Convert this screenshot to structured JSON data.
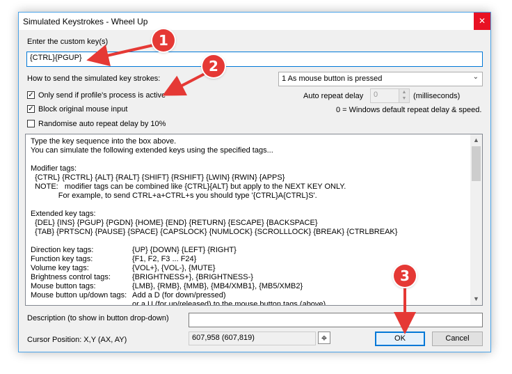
{
  "window": {
    "title": "Simulated Keystrokes - Wheel Up",
    "close_glyph": "✕"
  },
  "custom_key": {
    "label": "Enter the custom key(s)",
    "value": "{CTRL}{PGUP}"
  },
  "send_method": {
    "label": "How to send the simulated key strokes:",
    "selected": "1 As mouse button is pressed"
  },
  "options": {
    "only_send": {
      "label": "Only send if profile's process is active",
      "checked": true
    },
    "block_input": {
      "label": "Block original mouse input",
      "checked": true
    },
    "randomise": {
      "label": "Randomise auto repeat delay by 10%",
      "checked": false
    }
  },
  "auto_repeat": {
    "label": "Auto repeat delay",
    "value": "0",
    "units": "(milliseconds)",
    "note": "0 = Windows default repeat delay & speed."
  },
  "help_lines": [
    {
      "c1": "Type the key sequence into the box above.",
      "c2": ""
    },
    {
      "c1": "You can simulate the following extended keys using the specified tags...",
      "c2": ""
    },
    {
      "c1": "",
      "c2": ""
    },
    {
      "c1": "Modifier tags:",
      "c2": ""
    },
    {
      "c1": "  {CTRL} {RCTRL} {ALT} {RALT} {SHIFT} {RSHIFT} {LWIN} {RWIN} {APPS}",
      "c2": ""
    },
    {
      "c1": "  NOTE:   modifier tags can be combined like {CTRL}{ALT} but apply to the NEXT KEY ONLY.",
      "c2": ""
    },
    {
      "c1": "             For example, to send CTRL+a+CTRL+s you should type '{CTRL}A{CTRL}S'.",
      "c2": ""
    },
    {
      "c1": "",
      "c2": ""
    },
    {
      "c1": "Extended key tags:",
      "c2": ""
    },
    {
      "c1": "  {DEL} {INS} {PGUP} {PGDN} {HOME} {END} {RETURN} {ESCAPE} {BACKSPACE}",
      "c2": ""
    },
    {
      "c1": "  {TAB} {PRTSCN} {PAUSE} {SPACE} {CAPSLOCK} {NUMLOCK} {SCROLLLOCK} {BREAK} {CTRLBREAK}",
      "c2": ""
    },
    {
      "c1": "",
      "c2": ""
    },
    {
      "c1": "Direction key tags:",
      "c2": "{UP} {DOWN} {LEFT} {RIGHT}"
    },
    {
      "c1": "Function key tags:",
      "c2": "{F1, F2, F3 ... F24}"
    },
    {
      "c1": "Volume key tags:",
      "c2": "{VOL+}, {VOL-}, {MUTE}"
    },
    {
      "c1": "Brightness control tags:",
      "c2": "{BRIGHTNESS+}, {BRIGHTNESS-}"
    },
    {
      "c1": "Mouse button tags:",
      "c2": "{LMB}, {RMB}, {MMB}, {MB4/XMB1}, {MB5/XMB2}"
    },
    {
      "c1": "Mouse button up/down tags:",
      "c2": "Add a D (for down/pressed)"
    },
    {
      "c1": "",
      "c2": "or a U (for up/released) to the mouse button tags (above)"
    }
  ],
  "scroll": {
    "up_glyph": "▲",
    "down_glyph": "▼"
  },
  "description": {
    "label": "Description (to show in button drop-down)",
    "value": ""
  },
  "cursor": {
    "label": "Cursor Position: X,Y (AX, AY)",
    "value": "607,958 (607,819)",
    "crosshair_glyph": "⌖"
  },
  "buttons": {
    "ok": "OK",
    "cancel": "Cancel"
  },
  "annotations": [
    "1",
    "2",
    "3"
  ],
  "colors": {
    "accent": "#0078d7",
    "annotation": "#e53935",
    "close": "#e81123"
  }
}
